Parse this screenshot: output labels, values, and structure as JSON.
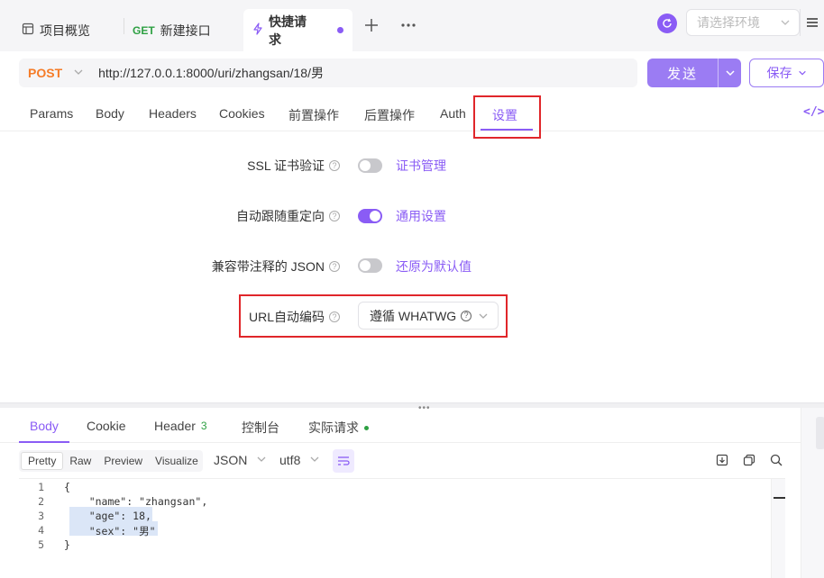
{
  "tabs": [
    {
      "label": "项目概览",
      "icon": "overview-icon"
    },
    {
      "method": "GET",
      "label": "新建接口"
    },
    {
      "label": "快捷请求",
      "icon": "lightning-icon"
    }
  ],
  "env": {
    "placeholder": "请选择环境"
  },
  "request": {
    "method": "POST",
    "url": "http://127.0.0.1:8000/uri/zhangsan/18/男",
    "send_label": "发送",
    "save_label": "保存"
  },
  "request_tabs": [
    "Params",
    "Body",
    "Headers",
    "Cookies",
    "前置操作",
    "后置操作",
    "Auth",
    "设置"
  ],
  "settings": {
    "ssl": {
      "label": "SSL 证书验证",
      "link": "证书管理",
      "enabled": false
    },
    "redirect": {
      "label": "自动跟随重定向",
      "link": "通用设置",
      "enabled": true
    },
    "json_comments": {
      "label": "兼容带注释的 JSON",
      "link": "还原为默认值",
      "enabled": false
    },
    "url_encode": {
      "label": "URL自动编码",
      "value": "遵循 WHATWG"
    }
  },
  "response_tabs": {
    "body": "Body",
    "cookie": "Cookie",
    "header": "Header",
    "header_count": "3",
    "console": "控制台",
    "actual": "实际请求"
  },
  "view_modes": [
    "Pretty",
    "Raw",
    "Preview",
    "Visualize"
  ],
  "format": "JSON",
  "encoding": "utf8",
  "code_lines": [
    {
      "num": "1",
      "text": "{"
    },
    {
      "num": "2",
      "text": "    \"name\": \"zhangsan\","
    },
    {
      "num": "3",
      "text": "    \"age\": 18,"
    },
    {
      "num": "4",
      "text": "    \"sex\": \"男\""
    },
    {
      "num": "5",
      "text": "}"
    }
  ],
  "colors": {
    "accent": "#8a5cf5",
    "method_post": "#f57c28",
    "get": "#2ea043",
    "highlight_box": "#e0262a"
  }
}
